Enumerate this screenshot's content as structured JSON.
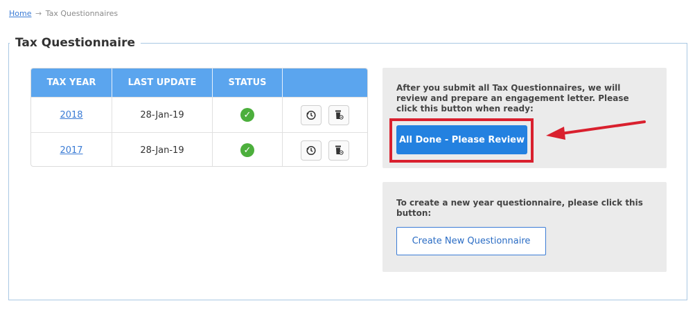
{
  "breadcrumb": {
    "home": "Home",
    "separator": "→",
    "current": "Tax Questionnaires"
  },
  "section_title": "Tax Questionnaire",
  "table": {
    "headers": [
      "TAX YEAR",
      "LAST UPDATE",
      "STATUS",
      ""
    ],
    "rows": [
      {
        "year": "2018",
        "last_update": "28-Jan-19",
        "status": "complete"
      },
      {
        "year": "2017",
        "last_update": "28-Jan-19",
        "status": "complete"
      }
    ]
  },
  "review_panel": {
    "text": "After you submit all Tax Questionnaires, we will review and prepare an engagement letter. Please click this button when ready:",
    "button_label": "All Done - Please Review"
  },
  "create_panel": {
    "text": "To create a new year questionnaire, please click this button:",
    "button_label": "Create New Questionnaire"
  },
  "colors": {
    "table_header": "#5ba5ee",
    "primary_button": "#2381e0",
    "highlight": "#d9202e",
    "status_ok": "#4caf3c"
  },
  "icons": [
    "history-icon",
    "delete-icon",
    "check-circle-icon",
    "arrow-annotation"
  ]
}
